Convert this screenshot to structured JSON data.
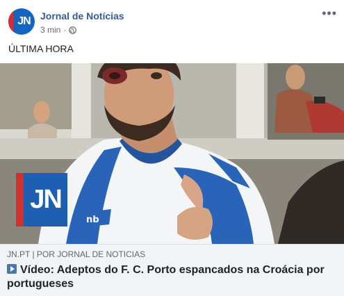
{
  "header": {
    "avatar_text": "JN",
    "page_name": "Jornal de Notícias",
    "time": "3 min",
    "dot": "·",
    "privacy_icon": "globe-icon",
    "more_label": "•••"
  },
  "post": {
    "text": "ÚLTIMA HORA"
  },
  "media": {
    "overlay_logo": "JN",
    "jersey_brand_icon": "new-balance-logo"
  },
  "link": {
    "source": "JN.PT | POR JORNAL DE NOTICIAS",
    "title": "Vídeo: Adeptos do F. C. Porto espancados na Croácia por portugueses",
    "title_icon": "video-play-icon"
  },
  "colors": {
    "brand_blue": "#385898",
    "jn_blue": "#1f5fb2",
    "jn_red": "#d32f2f",
    "link_bg": "#f2f3f5"
  }
}
